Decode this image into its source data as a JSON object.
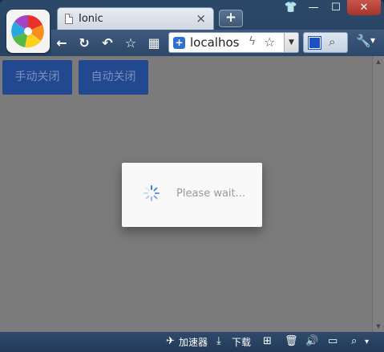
{
  "window": {
    "tab_title": "Ionic",
    "tab_close": "×",
    "new_tab": "+"
  },
  "controls": {
    "shirt": "👕",
    "minimize": "—",
    "maximize": "☐",
    "close": "✕"
  },
  "toolbar": {
    "back": "←",
    "reload": "↻",
    "undo": "↶",
    "favorite": "☆",
    "apps": "▦"
  },
  "address": {
    "url": "localhos",
    "bolt": "ϟ",
    "star": "☆",
    "drop": "▼"
  },
  "search": {
    "mag": "⌕"
  },
  "menu": {
    "wrench": "🔧",
    "drop": "▼"
  },
  "page": {
    "manual_close": "手动关闭",
    "auto_close": "自动关闭",
    "loading_text": "Please wait..."
  },
  "scrollbar": {
    "up": "▲",
    "down": "▼"
  },
  "statusbar": {
    "accelerator": "加速器",
    "download": "下载",
    "accelerator_icon": "✈",
    "download_icon": "⤓",
    "plus_icon": "⊞",
    "trash_icon": "🗑",
    "sound_icon": "🔊",
    "screen_icon": "▭",
    "zoom_icon": "⌕",
    "zoom_drop": "▾"
  },
  "colors": {
    "button_bg": "#22498f",
    "overlay": "#7b7b7b",
    "spinner": "#3b7de0"
  }
}
